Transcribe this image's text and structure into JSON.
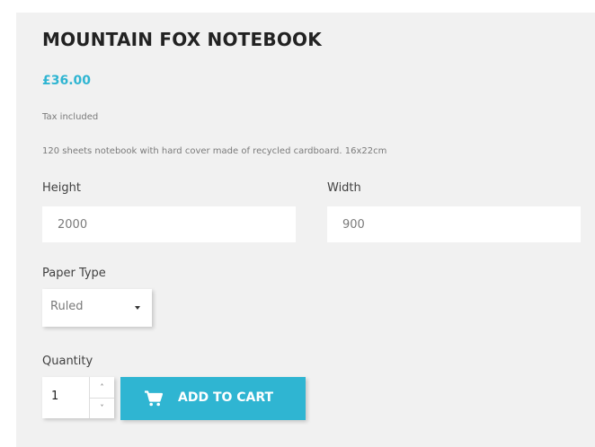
{
  "product": {
    "title": "MOUNTAIN FOX NOTEBOOK",
    "price": "£36.00",
    "tax_note": "Tax included",
    "description": "120 sheets notebook with hard cover made of recycled cardboard. 16x22cm"
  },
  "customization": {
    "height_label": "Height",
    "height_value": "2000",
    "width_label": "Width",
    "width_value": "900",
    "paper_type_label": "Paper Type",
    "paper_type_selected": "Ruled"
  },
  "quantity": {
    "label": "Quantity",
    "value": "1",
    "up_glyph": "˄",
    "down_glyph": "˅"
  },
  "cart": {
    "add_label": "ADD TO CART",
    "icon": "shopping-cart-icon"
  },
  "colors": {
    "accent": "#2fb5d2",
    "panel_background": "#f1f1f1",
    "title_text": "#222222"
  }
}
